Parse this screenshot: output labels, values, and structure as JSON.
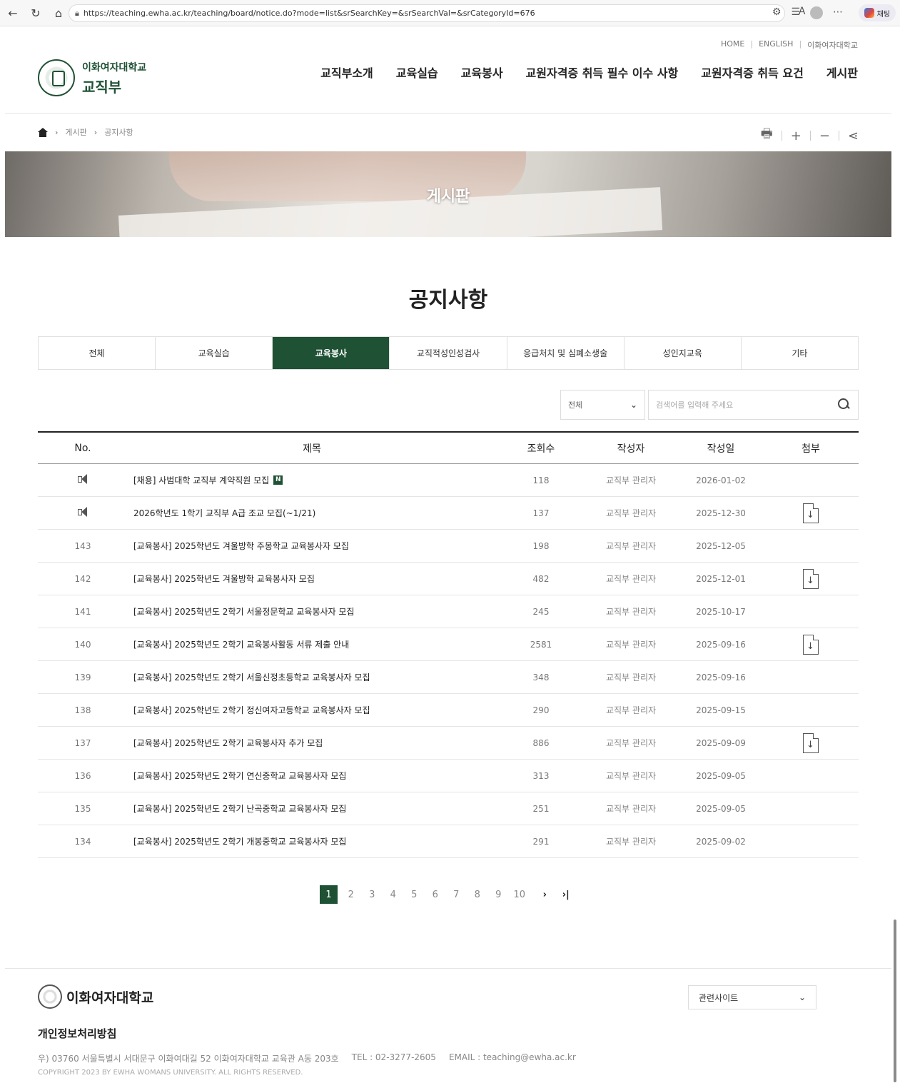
{
  "browser": {
    "url": "https://teaching.ewha.ac.kr/teaching/board/notice.do?mode=list&srSearchKey=&srSearchVal=&srCategoryId=676",
    "copilot_label": "채팅"
  },
  "header": {
    "util_links": [
      "HOME",
      "ENGLISH",
      "이화여자대학교"
    ],
    "univ_name": "이화여자대학교",
    "dept_name": "교직부",
    "gnb": [
      "교직부소개",
      "교육실습",
      "교육봉사",
      "교원자격증 취득 필수 이수 사항",
      "교원자격증 취득 요건",
      "게시판"
    ]
  },
  "breadcrumb": [
    "게시판",
    "공지사항"
  ],
  "banner_title": "게시판",
  "page_title": "공지사항",
  "tabs": [
    "전체",
    "교육실습",
    "교육봉사",
    "교직적성인성검사",
    "응급처치 및 심폐소생술",
    "성인지교육",
    "기타"
  ],
  "active_tab": "교육봉사",
  "search": {
    "select_value": "전체",
    "placeholder": "검색어를 입력해 주세요"
  },
  "table": {
    "headers": [
      "No.",
      "제목",
      "조회수",
      "작성자",
      "작성일",
      "첨부"
    ],
    "rows": [
      {
        "no": "",
        "notice": true,
        "title": "[채용] 사범대학 교직부 계약직원 모집",
        "is_new": true,
        "views": "118",
        "author": "교직부 관리자",
        "date": "2026-01-02",
        "attach": false
      },
      {
        "no": "",
        "notice": true,
        "title": "2026학년도 1학기 교직부 A급 조교 모집(~1/21)",
        "is_new": false,
        "views": "137",
        "author": "교직부 관리자",
        "date": "2025-12-30",
        "attach": true
      },
      {
        "no": "143",
        "notice": false,
        "title": "[교육봉사] 2025학년도 겨울방학 주몽학교 교육봉사자 모집",
        "is_new": false,
        "views": "198",
        "author": "교직부 관리자",
        "date": "2025-12-05",
        "attach": false
      },
      {
        "no": "142",
        "notice": false,
        "title": "[교육봉사] 2025학년도 겨울방학 교육봉사자 모집",
        "is_new": false,
        "views": "482",
        "author": "교직부 관리자",
        "date": "2025-12-01",
        "attach": true
      },
      {
        "no": "141",
        "notice": false,
        "title": "[교육봉사] 2025학년도 2학기 서울정문학교 교육봉사자 모집",
        "is_new": false,
        "views": "245",
        "author": "교직부 관리자",
        "date": "2025-10-17",
        "attach": false
      },
      {
        "no": "140",
        "notice": false,
        "title": "[교육봉사] 2025학년도 2학기 교육봉사활동 서류 제출 안내",
        "is_new": false,
        "views": "2581",
        "author": "교직부 관리자",
        "date": "2025-09-16",
        "attach": true
      },
      {
        "no": "139",
        "notice": false,
        "title": "[교육봉사] 2025학년도 2학기 서울신정초등학교 교육봉사자 모집",
        "is_new": false,
        "views": "348",
        "author": "교직부 관리자",
        "date": "2025-09-16",
        "attach": false
      },
      {
        "no": "138",
        "notice": false,
        "title": "[교육봉사] 2025학년도 2학기 정신여자고등학교 교육봉사자 모집",
        "is_new": false,
        "views": "290",
        "author": "교직부 관리자",
        "date": "2025-09-15",
        "attach": false
      },
      {
        "no": "137",
        "notice": false,
        "title": "[교육봉사] 2025학년도 2학기 교육봉사자 추가 모집",
        "is_new": false,
        "views": "886",
        "author": "교직부 관리자",
        "date": "2025-09-09",
        "attach": true
      },
      {
        "no": "136",
        "notice": false,
        "title": "[교육봉사] 2025학년도 2학기 연신중학교 교육봉사자 모집",
        "is_new": false,
        "views": "313",
        "author": "교직부 관리자",
        "date": "2025-09-05",
        "attach": false
      },
      {
        "no": "135",
        "notice": false,
        "title": "[교육봉사] 2025학년도 2학기 난곡중학교 교육봉사자 모집",
        "is_new": false,
        "views": "251",
        "author": "교직부 관리자",
        "date": "2025-09-05",
        "attach": false
      },
      {
        "no": "134",
        "notice": false,
        "title": "[교육봉사] 2025학년도 2학기 개봉중학교 교육봉사자 모집",
        "is_new": false,
        "views": "291",
        "author": "교직부 관리자",
        "date": "2025-09-02",
        "attach": false
      }
    ]
  },
  "new_badge": "N",
  "pagination": {
    "pages": [
      "1",
      "2",
      "3",
      "4",
      "5",
      "6",
      "7",
      "8",
      "9",
      "10"
    ],
    "current": "1",
    "next": "›",
    "last": "›|"
  },
  "footer": {
    "univ_name": "이화여자대학교",
    "related_sites": "관련사이트",
    "privacy": "개인정보처리방침",
    "address": "우) 03760 서울특별시 서대문구 이화여대길 52 이화여자대학교 교육관 A동 203호",
    "tel": "TEL : 02-3277-2605",
    "email": "EMAIL : teaching@ewha.ac.kr",
    "copyright": "COPYRIGHT 2023 BY EWHA WOMANS UNIVERSITY. ALL RIGHTS RESERVED."
  },
  "colors": {
    "brand_green": "#1f5135"
  },
  "icons": [
    "back-icon",
    "refresh-icon",
    "home-icon",
    "lock-icon",
    "read-aloud-icon",
    "favorite-icon",
    "extensions-icon",
    "favorites-list-icon",
    "profile-icon",
    "more-icon",
    "print-icon",
    "zoom-in-icon",
    "zoom-out-icon",
    "share-icon",
    "search-icon",
    "chevron-down-icon",
    "notice-icon",
    "file-download-icon"
  ]
}
